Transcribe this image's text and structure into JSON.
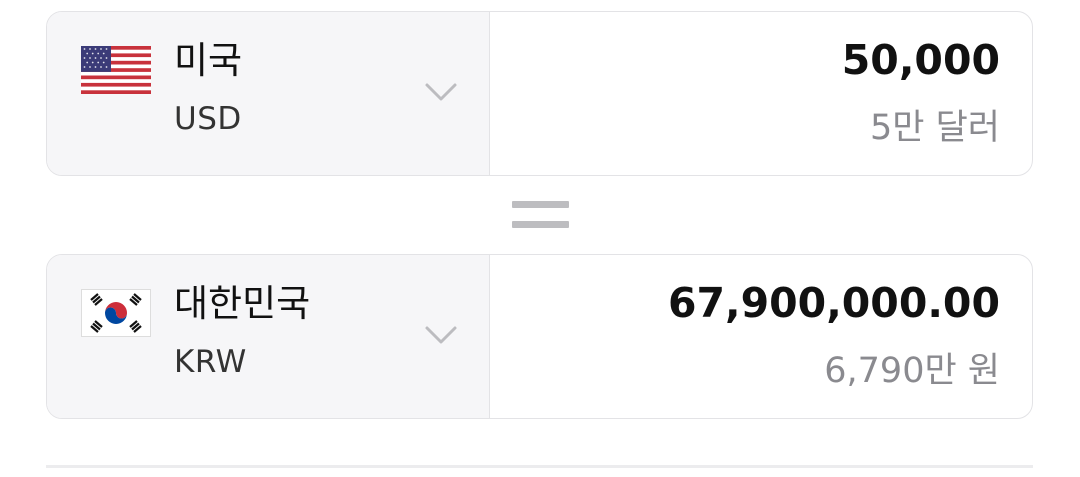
{
  "from": {
    "country": "미국",
    "code": "USD",
    "flag_icon": "us-flag-icon",
    "amount": "50,000",
    "amount_in_words": "5만 달러"
  },
  "equals_symbol_icon": "equals-icon",
  "to": {
    "country": "대한민국",
    "code": "KRW",
    "flag_icon": "kr-flag-icon",
    "amount": "67,900,000.00",
    "amount_in_words": "6,790만 원"
  },
  "colors": {
    "selector_bg": "#f6f6f8",
    "border": "#e3e3e6",
    "secondary_text": "#8a8a8f",
    "equals": "#bdbdc0"
  }
}
